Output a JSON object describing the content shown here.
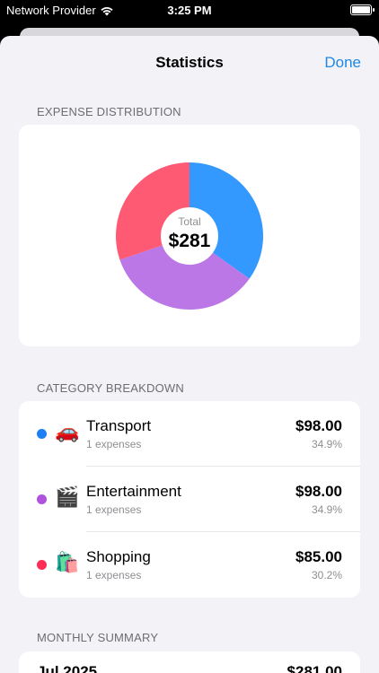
{
  "status_bar": {
    "carrier": "Network Provider",
    "time": "3:25 PM"
  },
  "nav": {
    "title": "Statistics",
    "done_label": "Done"
  },
  "sections": {
    "distribution": "EXPENSE DISTRIBUTION",
    "breakdown": "CATEGORY BREAKDOWN",
    "monthly": "MONTHLY SUMMARY"
  },
  "chart_data": {
    "type": "pie",
    "center_label": "Total",
    "center_value": "$281",
    "slices": [
      {
        "name": "Transport",
        "value": 98.0,
        "color": "#3399ff"
      },
      {
        "name": "Entertainment",
        "value": 98.0,
        "color": "#bb77e6"
      },
      {
        "name": "Shopping",
        "value": 85.0,
        "color": "#ff5a73"
      }
    ]
  },
  "categories": [
    {
      "emoji": "🚗",
      "name": "Transport",
      "count": "1 expenses",
      "amount": "$98.00",
      "percent": "34.9%",
      "color": "#1e7ff5"
    },
    {
      "emoji": "🎬",
      "name": "Entertainment",
      "count": "1 expenses",
      "amount": "$98.00",
      "percent": "34.9%",
      "color": "#af52de"
    },
    {
      "emoji": "🛍️",
      "name": "Shopping",
      "count": "1 expenses",
      "amount": "$85.00",
      "percent": "30.2%",
      "color": "#ff2d55"
    }
  ],
  "monthly": [
    {
      "month": "Jul 2025",
      "total": "$281.00"
    }
  ],
  "colors": {
    "accent": "#1e88e5",
    "sheet_background": "#f2f2f7"
  }
}
